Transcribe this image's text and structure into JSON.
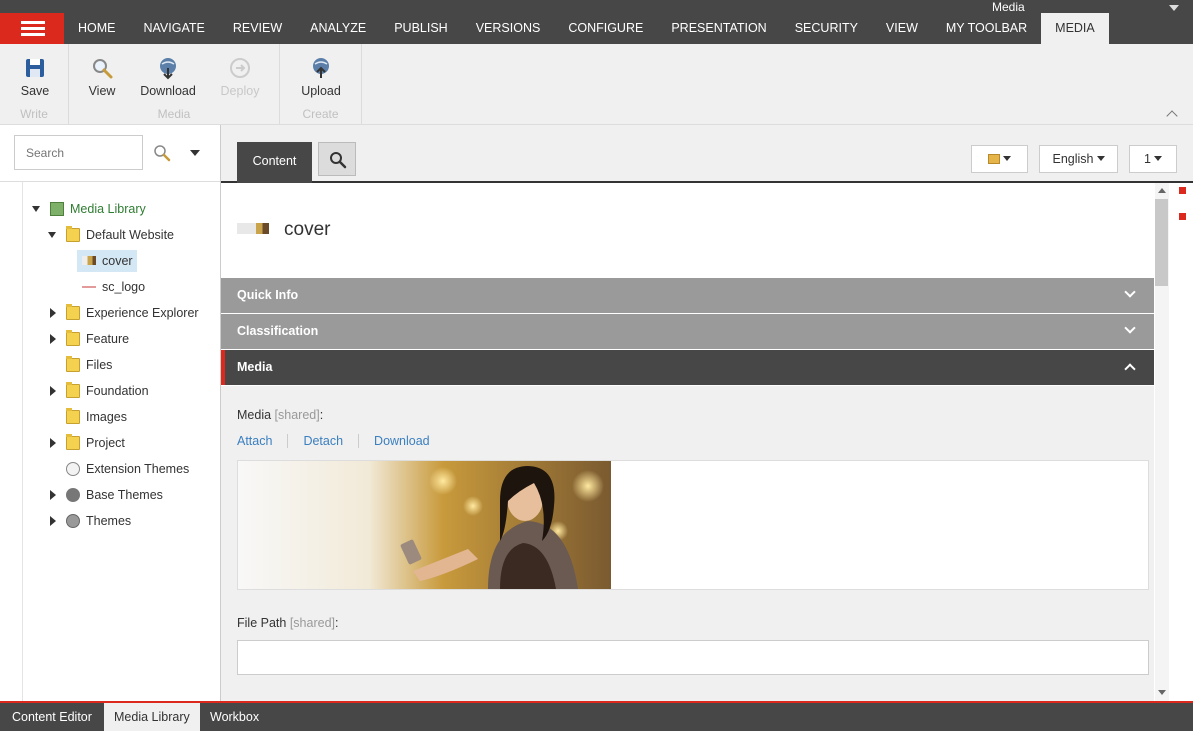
{
  "topbar": {
    "context_label": "Media",
    "tabs": [
      "HOME",
      "NAVIGATE",
      "REVIEW",
      "ANALYZE",
      "PUBLISH",
      "VERSIONS",
      "CONFIGURE",
      "PRESENTATION",
      "SECURITY",
      "VIEW",
      "MY TOOLBAR",
      "MEDIA"
    ],
    "active_tab": "MEDIA"
  },
  "ribbon": {
    "groups": [
      {
        "label": "Write",
        "buttons": [
          {
            "label": "Save",
            "icon": "save-icon"
          }
        ]
      },
      {
        "label": "Media",
        "buttons": [
          {
            "label": "View",
            "icon": "magnifier-icon"
          },
          {
            "label": "Download",
            "icon": "globe-download-icon"
          },
          {
            "label": "Deploy",
            "icon": "deploy-icon",
            "disabled": true
          }
        ]
      },
      {
        "label": "Create",
        "buttons": [
          {
            "label": "Upload",
            "icon": "globe-upload-icon"
          }
        ]
      }
    ]
  },
  "search": {
    "placeholder": "Search"
  },
  "tree": [
    {
      "label": "Media Library",
      "expanded": true,
      "icon": "media-library-icon",
      "color": "#2f7d32"
    },
    {
      "label": "Default Website",
      "expanded": true,
      "icon": "folder-icon"
    },
    {
      "label": "cover",
      "selected": true,
      "icon": "image-icon"
    },
    {
      "label": "sc_logo",
      "icon": "image-icon"
    },
    {
      "label": "Experience Explorer",
      "expanded": false,
      "icon": "folder-icon"
    },
    {
      "label": "Feature",
      "expanded": false,
      "icon": "folder-icon"
    },
    {
      "label": "Files",
      "icon": "folder-icon"
    },
    {
      "label": "Foundation",
      "expanded": false,
      "icon": "folder-icon"
    },
    {
      "label": "Images",
      "icon": "folder-icon"
    },
    {
      "label": "Project",
      "expanded": false,
      "icon": "folder-icon"
    },
    {
      "label": "Extension Themes",
      "icon": "theme-icon"
    },
    {
      "label": "Base Themes",
      "expanded": false,
      "icon": "theme-icon"
    },
    {
      "label": "Themes",
      "expanded": false,
      "icon": "theme-icon"
    }
  ],
  "editor": {
    "tab_label": "Content",
    "language": "English",
    "version": "1",
    "item_title": "cover",
    "sections": [
      {
        "label": "Quick Info",
        "expanded": false
      },
      {
        "label": "Classification",
        "expanded": false
      },
      {
        "label": "Media",
        "expanded": true
      }
    ],
    "media_field": {
      "label": "Media",
      "shared": "[shared]",
      "suffix": ":"
    },
    "media_links": [
      "Attach",
      "Detach",
      "Download"
    ],
    "file_path_field": {
      "label": "File Path",
      "shared": "[shared]",
      "suffix": ":",
      "value": ""
    }
  },
  "bottom_tabs": [
    "Content Editor",
    "Media Library",
    "Workbox"
  ],
  "bottom_active": "Media Library",
  "colors": {
    "accent": "#dc291e",
    "dark": "#474747",
    "link": "#3a7fc0"
  }
}
